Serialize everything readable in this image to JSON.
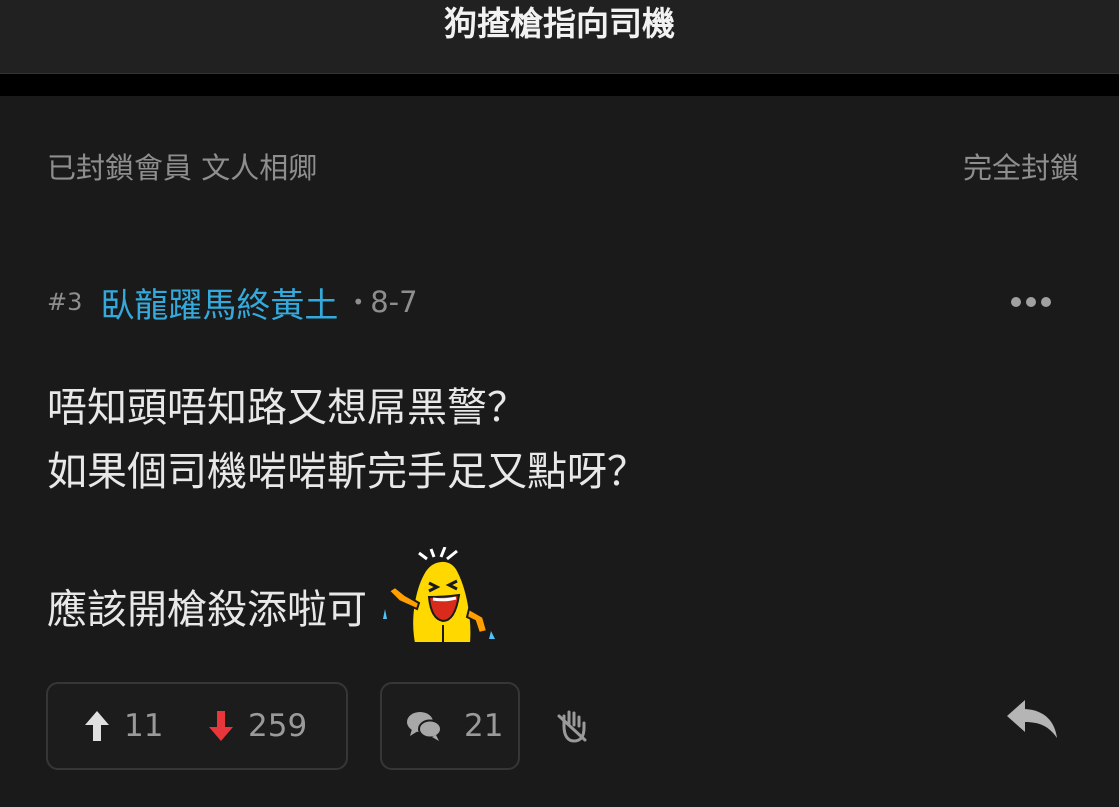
{
  "header": {
    "title": "狗揸槍指向司機"
  },
  "blocked_notice": {
    "label": "已封鎖會員 文人相卿",
    "action": "完全封鎖"
  },
  "post": {
    "number": "#3",
    "author": "臥龍躍馬終黃土",
    "separator": "•",
    "date": "8-7",
    "lines": [
      "唔知頭唔知路又想屌黑警？",
      "如果個司機啱啱斬完手足又點呀？",
      "應該開槍殺添啦可"
    ],
    "sticker": "laughing-sticker",
    "upvotes": "11",
    "downvotes": "259",
    "comments": "21",
    "icons": {
      "upvote": "arrow-up-icon",
      "downvote": "arrow-down-icon",
      "comment": "comment-bubbles-icon",
      "hand": "hand-icon",
      "reply": "reply-icon",
      "more": "more-dots-icon"
    },
    "colors": {
      "author": "#34aadc",
      "downvote": "#e8363a",
      "upvote": "#e0e0e0"
    }
  }
}
